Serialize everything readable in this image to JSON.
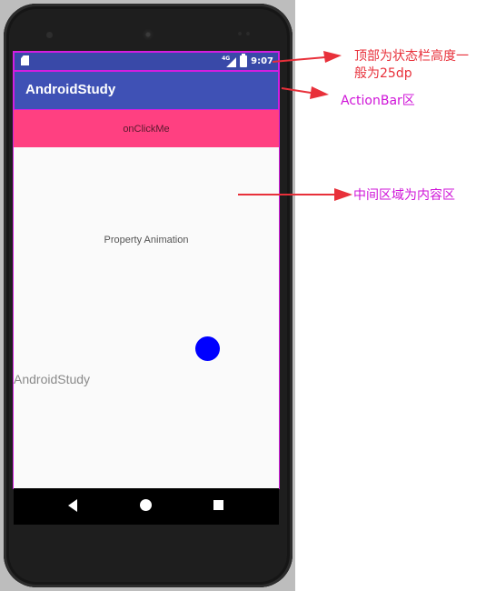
{
  "status_bar": {
    "network_label": "4G",
    "time": "9:07"
  },
  "action_bar": {
    "title": "AndroidStudy"
  },
  "content": {
    "button_label": "onClickMe",
    "animation_label": "Property Animation",
    "app_label": "AndroidStudy",
    "circle_color": "#0000ff"
  },
  "annotations": {
    "status_bar_note_line1": "顶部为状态栏高度一",
    "status_bar_note_line2": "般为25dp",
    "action_bar_note": "ActionBar区",
    "content_note": "中间区域为内容区"
  },
  "colors": {
    "status_bar": "#3949a8",
    "action_bar": "#3f51b5",
    "button": "#ff4081",
    "annotation_red": "#e8303a",
    "annotation_magenta": "#cf14d8"
  },
  "nav_bar": {
    "icons": [
      "back-icon",
      "home-icon",
      "recent-apps-icon"
    ]
  }
}
